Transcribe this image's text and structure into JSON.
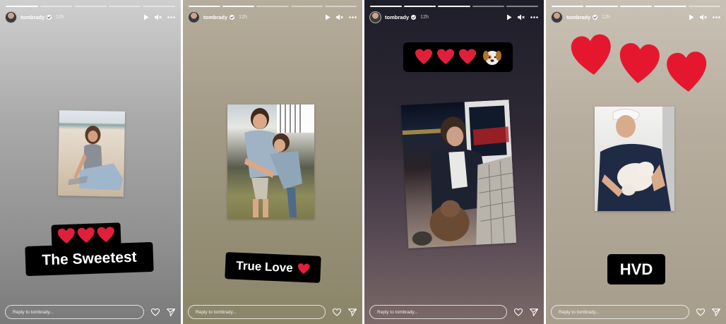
{
  "stories": [
    {
      "username": "tombrady",
      "age": "12h",
      "reply_placeholder": "Reply to tombrady...",
      "sticker_emoji": "❤️❤️❤️",
      "sticker_text": "The Sweetest",
      "photo_alt": "Girl sitting on a beach",
      "progress": {
        "total": 5,
        "active": 1
      }
    },
    {
      "username": "tombrady",
      "age": "12h",
      "reply_placeholder": "Reply to tombrady...",
      "sticker_text": "True Love",
      "sticker_emoji": "❤️",
      "photo_alt": "Two siblings hugging outdoors",
      "progress": {
        "total": 5,
        "active": 2
      }
    },
    {
      "username": "tombrady",
      "age": "12h",
      "reply_placeholder": "Reply to tombrady...",
      "sticker_emoji": "❤️❤️❤️🐶",
      "photo_alt": "Boy sitting with a dog on a balcony at night",
      "progress": {
        "total": 5,
        "active": 3
      }
    },
    {
      "username": "tombrady",
      "age": "12h",
      "reply_placeholder": "Reply to tombrady...",
      "emoji_hearts": "❤️❤️❤️",
      "sticker_text": "HVD",
      "photo_alt": "Boy in a cap holding a white puppy",
      "progress": {
        "total": 5,
        "active": 4
      }
    }
  ],
  "icons": [
    "play-icon",
    "mute-icon",
    "more-icon",
    "heart-icon",
    "send-icon",
    "verified-icon"
  ],
  "colors": {
    "heart": "#e0203a",
    "sticker_bg": "#000000",
    "text": "#ffffff"
  }
}
